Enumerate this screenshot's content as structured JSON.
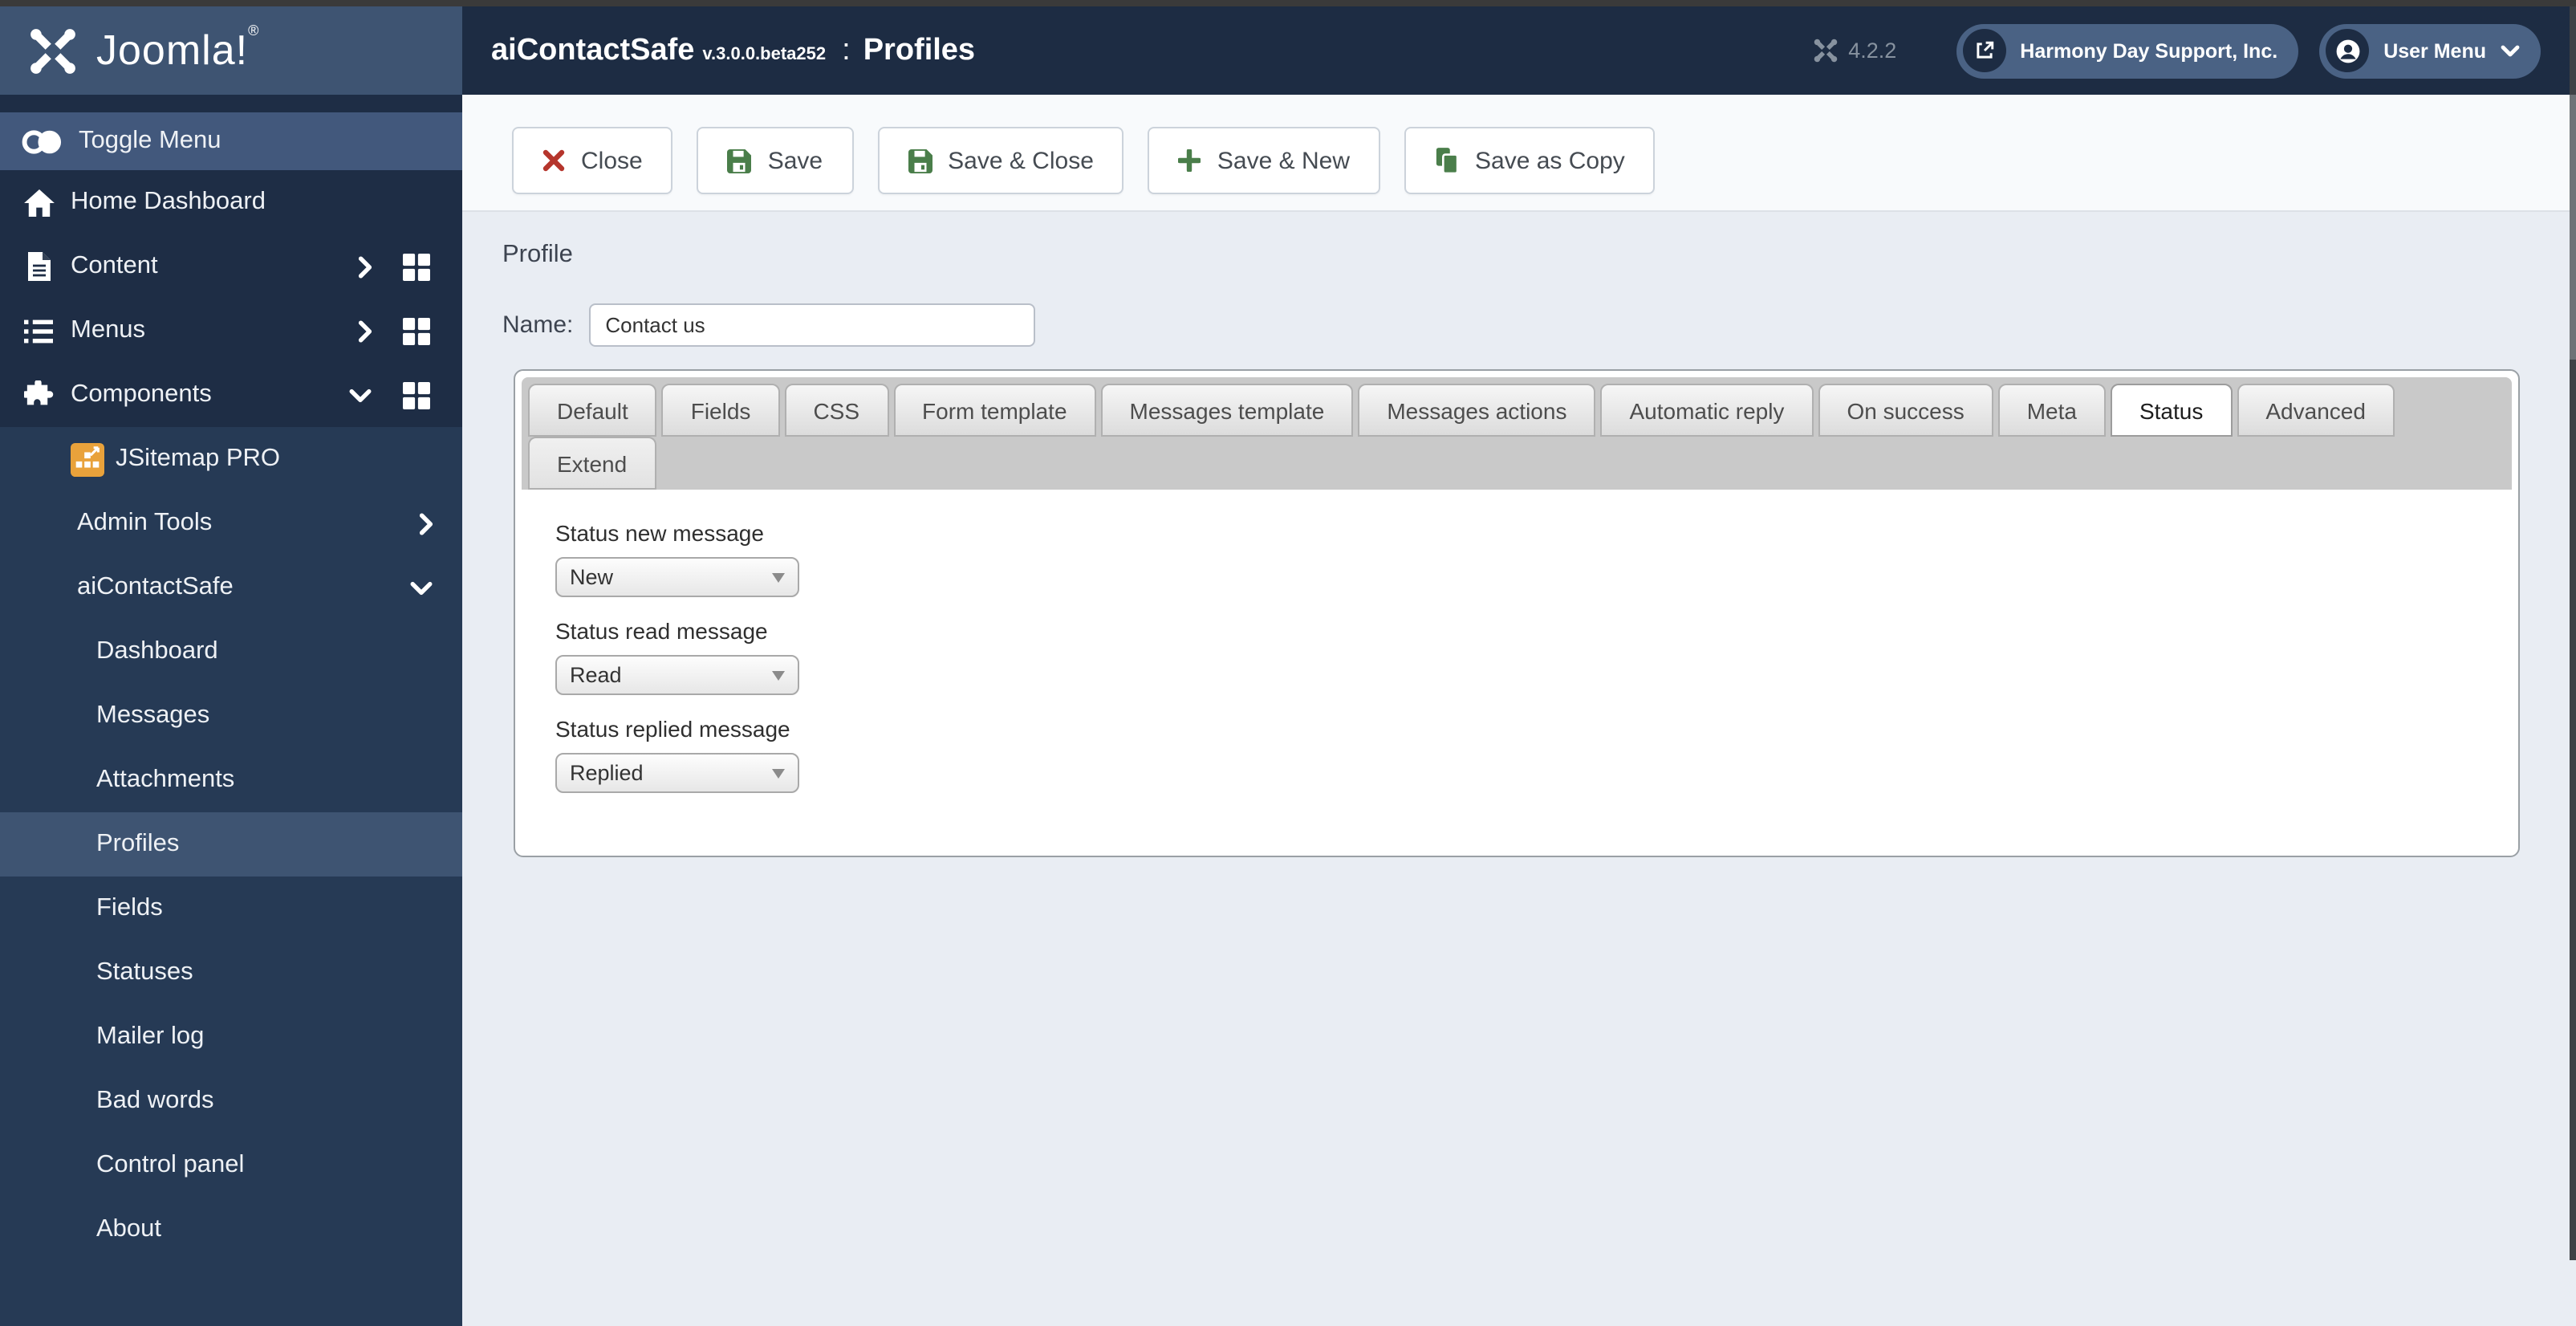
{
  "header": {
    "brand": "Joomla!",
    "brand_reg": "®",
    "app_name": "aiContactSafe",
    "app_version": "v.3.0.0.beta252",
    "separator": ":",
    "page_title": "Profiles",
    "joomla_version": "4.2.2",
    "site_name": "Harmony Day Support, Inc.",
    "user_menu_label": "User Menu"
  },
  "sidebar": {
    "toggle_label": "Toggle Menu",
    "items": [
      {
        "label": "Home Dashboard",
        "icon": "home-icon",
        "level": 0
      },
      {
        "label": "Content",
        "icon": "file-icon",
        "level": 0,
        "chevron": "right",
        "grid": true
      },
      {
        "label": "Menus",
        "icon": "list-icon",
        "level": 0,
        "chevron": "right",
        "grid": true
      },
      {
        "label": "Components",
        "icon": "puzzle-icon",
        "level": 0,
        "chevron": "down",
        "grid": true
      },
      {
        "label": "JSitemap PRO",
        "icon": "jsitemap-icon",
        "level": 1
      },
      {
        "label": "Admin Tools",
        "level": 1,
        "chevron": "right"
      },
      {
        "label": "aiContactSafe",
        "level": 1,
        "chevron": "down"
      },
      {
        "label": "Dashboard",
        "level": 2
      },
      {
        "label": "Messages",
        "level": 2
      },
      {
        "label": "Attachments",
        "level": 2
      },
      {
        "label": "Profiles",
        "level": 2,
        "active": true
      },
      {
        "label": "Fields",
        "level": 2
      },
      {
        "label": "Statuses",
        "level": 2
      },
      {
        "label": "Mailer log",
        "level": 2
      },
      {
        "label": "Bad words",
        "level": 2
      },
      {
        "label": "Control panel",
        "level": 2
      },
      {
        "label": "About",
        "level": 2
      }
    ]
  },
  "toolbar": {
    "buttons": [
      {
        "label": "Close",
        "icon": "close-icon"
      },
      {
        "label": "Save",
        "icon": "save-icon"
      },
      {
        "label": "Save & Close",
        "icon": "save-icon"
      },
      {
        "label": "Save & New",
        "icon": "plus-icon"
      },
      {
        "label": "Save as Copy",
        "icon": "copy-icon"
      }
    ]
  },
  "content": {
    "heading": "Profile",
    "name_label": "Name:",
    "name_value": "Contact us",
    "tabs": [
      {
        "label": "Default"
      },
      {
        "label": "Fields"
      },
      {
        "label": "CSS"
      },
      {
        "label": "Form template"
      },
      {
        "label": "Messages template"
      },
      {
        "label": "Messages actions"
      },
      {
        "label": "Automatic reply"
      },
      {
        "label": "On success"
      },
      {
        "label": "Meta"
      },
      {
        "label": "Status",
        "active": true
      },
      {
        "label": "Advanced"
      },
      {
        "label": "Extend"
      }
    ],
    "fields": [
      {
        "label": "Status new message",
        "value": "New"
      },
      {
        "label": "Status read message",
        "value": "Read"
      },
      {
        "label": "Status replied message",
        "value": "Replied"
      }
    ]
  },
  "colors": {
    "header_bg": "#1d2c43",
    "sidebar_bg": "#1e2d45",
    "submenu_bg": "#263a55",
    "highlight_bg": "#3e5472",
    "pill_bg": "#4a6284",
    "toolbar_green": "#4a7e4a",
    "toolbar_red": "#b5352c",
    "jsitemap_orange": "#e9a23b"
  }
}
